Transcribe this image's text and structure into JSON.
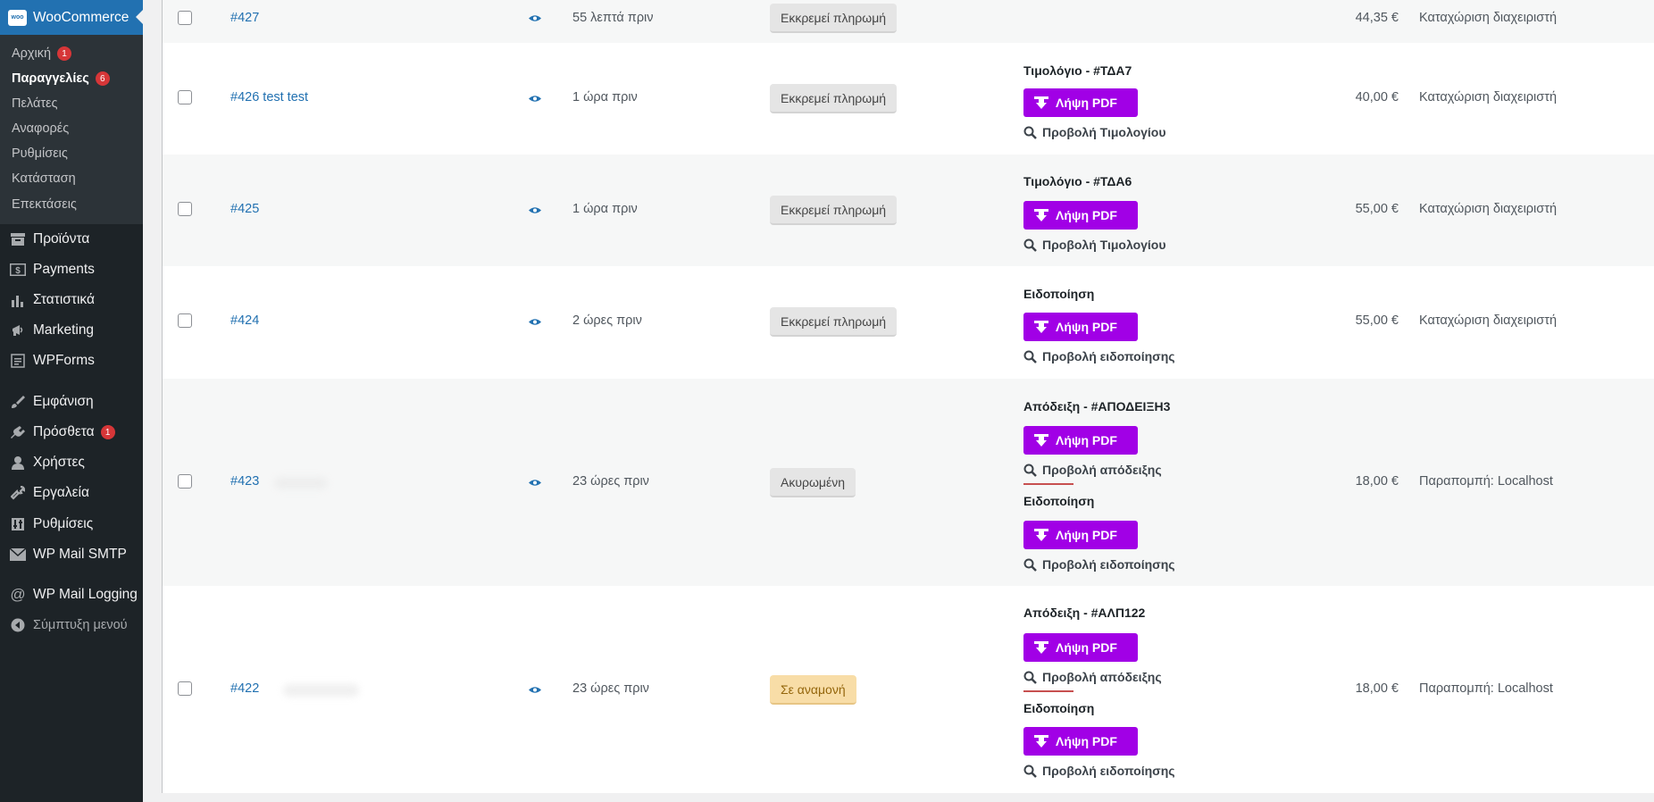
{
  "sidebar": {
    "brand": "WooCommerce",
    "brand_logo_text": "woo",
    "submenu": [
      {
        "label": "Αρχική",
        "badge": "1"
      },
      {
        "label": "Παραγγελίες",
        "badge": "6",
        "current": true
      },
      {
        "label": "Πελάτες"
      },
      {
        "label": "Αναφορές"
      },
      {
        "label": "Ρυθμίσεις"
      },
      {
        "label": "Κατάσταση"
      },
      {
        "label": "Επεκτάσεις"
      }
    ],
    "menu": [
      {
        "label": "Προϊόντα",
        "icon": "products-icon"
      },
      {
        "label": "Payments",
        "icon": "payments-icon"
      },
      {
        "label": "Στατιστικά",
        "icon": "stats-icon"
      },
      {
        "label": "Marketing",
        "icon": "megaphone-icon"
      },
      {
        "label": "WPForms",
        "icon": "wpforms-icon"
      },
      {
        "label": "Εμφάνιση",
        "icon": "brush-icon"
      },
      {
        "label": "Πρόσθετα",
        "icon": "plugin-icon",
        "badge": "1"
      },
      {
        "label": "Χρήστες",
        "icon": "users-icon"
      },
      {
        "label": "Εργαλεία",
        "icon": "wrench-icon"
      },
      {
        "label": "Ρυθμίσεις",
        "icon": "settings-icon"
      },
      {
        "label": "WP Mail SMTP",
        "icon": "mail-icon"
      },
      {
        "label": "WP Mail Logging",
        "icon": "at-icon"
      }
    ],
    "collapse_label": "Σύμπτυξη μενού"
  },
  "orders": [
    {
      "number": "#427",
      "date": "55 λεπτά πριν",
      "status": "Εκκρεμεί πληρωμή",
      "total": "44,35 €",
      "origin": "Καταχώριση διαχειριστή",
      "docs": []
    },
    {
      "number": "#426 test test",
      "date": "1 ώρα πριν",
      "status": "Εκκρεμεί πληρωμή",
      "total": "40,00 €",
      "origin": "Καταχώριση διαχειριστή",
      "docs": [
        {
          "title": "Τιμολόγιο - #ΤΔΑ7",
          "button": "Λήψη PDF",
          "view": "Προβολή Τιμολογίου"
        }
      ]
    },
    {
      "number": "#425",
      "date": "1 ώρα πριν",
      "status": "Εκκρεμεί πληρωμή",
      "total": "55,00 €",
      "origin": "Καταχώριση διαχειριστή",
      "docs": [
        {
          "title": "Τιμολόγιο - #ΤΔΑ6",
          "button": "Λήψη PDF",
          "view": "Προβολή Τιμολογίου"
        }
      ]
    },
    {
      "number": "#424",
      "date": "2 ώρες πριν",
      "status": "Εκκρεμεί πληρωμή",
      "total": "55,00 €",
      "origin": "Καταχώριση διαχειριστή",
      "docs": [
        {
          "title": "Ειδοποίηση",
          "button": "Λήψη PDF",
          "view": "Προβολή ειδοποίησης"
        }
      ]
    },
    {
      "number": "#423",
      "date": "23 ώρες πριν",
      "status": "Ακυρωμένη",
      "total": "18,00 €",
      "origin": "Παραπομπή: Localhost",
      "docs": [
        {
          "title": "Απόδειξη - #ΑΠΟΔΕΙΞΗ3",
          "button": "Λήψη PDF",
          "view": "Προβολή απόδειξης"
        },
        {
          "title": "Ειδοποίηση",
          "button": "Λήψη PDF",
          "view": "Προβολή ειδοποίησης"
        }
      ]
    },
    {
      "number": "#422",
      "date": "23 ώρες πριν",
      "status": "Σε αναμονή",
      "total": "18,00 €",
      "origin": "Παραπομπή: Localhost",
      "docs": [
        {
          "title": "Απόδειξη - #ΑΛΠ122",
          "button": "Λήψη PDF",
          "view": "Προβολή απόδειξης"
        },
        {
          "title": "Ειδοποίηση",
          "button": "Λήψη PDF",
          "view": "Προβολή ειδοποίησης"
        }
      ]
    }
  ]
}
